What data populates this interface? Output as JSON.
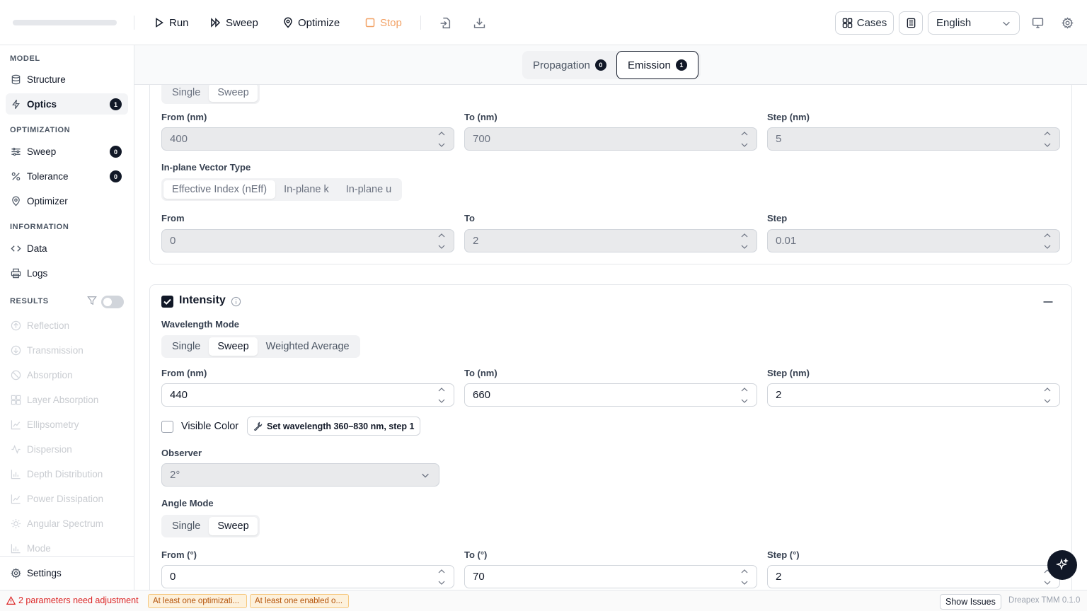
{
  "toolbar": {
    "run": "Run",
    "sweep": "Sweep",
    "optimize": "Optimize",
    "stop": "Stop",
    "cases": "Cases",
    "language": "English"
  },
  "sidebar": {
    "model_title": "MODEL",
    "structure": "Structure",
    "optics": "Optics",
    "optics_badge": "1",
    "optimization_title": "OPTIMIZATION",
    "sweep": "Sweep",
    "sweep_badge": "0",
    "tolerance": "Tolerance",
    "tolerance_badge": "0",
    "optimizer": "Optimizer",
    "information_title": "INFORMATION",
    "data": "Data",
    "logs": "Logs",
    "results_title": "RESULTS",
    "results": [
      "Reflection",
      "Transmission",
      "Absorption",
      "Layer Absorption",
      "Ellipsometry",
      "Dispersion",
      "Depth Distribution",
      "Power Dissipation",
      "Angular Spectrum",
      "Mode"
    ],
    "settings": "Settings"
  },
  "tabs": {
    "propagation": "Propagation",
    "propagation_badge": "0",
    "emission": "Emission",
    "emission_badge": "1"
  },
  "emission_card": {
    "mode_options": [
      "Single",
      "Sweep"
    ],
    "from_label": "From (nm)",
    "to_label": "To (nm)",
    "step_label": "Step (nm)",
    "from": "400",
    "to": "700",
    "step": "5",
    "vector_label": "In-plane Vector Type",
    "vector_options": [
      "Effective Index (nEff)",
      "In-plane k",
      "In-plane u"
    ],
    "v_from_label": "From",
    "v_to_label": "To",
    "v_step_label": "Step",
    "v_from": "0",
    "v_to": "2",
    "v_step": "0.01"
  },
  "intensity_card": {
    "title": "Intensity",
    "wavelength_mode_label": "Wavelength Mode",
    "wavelength_options": [
      "Single",
      "Sweep",
      "Weighted Average"
    ],
    "from_label": "From (nm)",
    "to_label": "To (nm)",
    "step_label": "Step (nm)",
    "from": "440",
    "to": "660",
    "step": "2",
    "visible_color": "Visible Color",
    "set_wavelength_btn": "Set wavelength 360–830 nm, step 1",
    "observer_label": "Observer",
    "observer_value": "2°",
    "angle_mode_label": "Angle Mode",
    "angle_options": [
      "Single",
      "Sweep"
    ],
    "a_from_label": "From (°)",
    "a_to_label": "To (°)",
    "a_step_label": "Step (°)",
    "a_from": "0",
    "a_to": "70",
    "a_step": "2"
  },
  "status": {
    "warning": "2 parameters need adjustment",
    "chip1": "At least one optimizati...",
    "chip2": "At least one enabled o...",
    "show_issues": "Show Issues",
    "version": "Dreapex TMM 0.1.0"
  }
}
